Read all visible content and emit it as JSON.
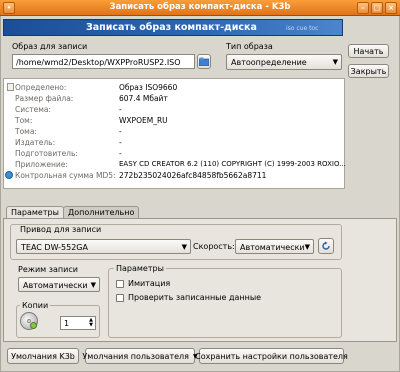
{
  "window": {
    "title": "Записать образ компакт-диска - K3b",
    "buttons": {
      "menu": "•",
      "minimize": "–",
      "maximize": "□",
      "close": "×"
    }
  },
  "header": {
    "title": "Записать образ компакт-диска",
    "subtitle": "iso cue toc"
  },
  "image_file": {
    "label": "Образ для записи",
    "value": "/home/wmd2/Desktop/WXPProRUSP2.ISO"
  },
  "image_type": {
    "label": "Тип образа",
    "value": "Автоопределение"
  },
  "actions": {
    "start": "Начать",
    "close": "Закрыть"
  },
  "info_rows": [
    {
      "key": "Определено:",
      "value": "Образ ISO9660"
    },
    {
      "key": "Размер файла:",
      "value": "607.4 Мбайт"
    },
    {
      "key": "Система:",
      "value": "-"
    },
    {
      "key": "Том:",
      "value": "WXPOEM_RU"
    },
    {
      "key": "Тома:",
      "value": "-"
    },
    {
      "key": "Издатель:",
      "value": "-"
    },
    {
      "key": "Подготовитель:",
      "value": "-"
    },
    {
      "key": "Приложение:",
      "value": "EASY CD CREATOR 6.2 (110) COPYRIGHT (C) 1999-2003 ROXIO..."
    },
    {
      "key": "Контрольная сумма MD5:",
      "value": "272b235024026afc84858fb5662a8711"
    }
  ],
  "tabs": {
    "params": "Параметры",
    "advanced": "Дополнительно"
  },
  "writer": {
    "label": "Привод для записи",
    "device": "TEAC DW-552GA",
    "speed_label": "Скорость:",
    "speed_value": "Автоматически"
  },
  "mode": {
    "label": "Режим записи",
    "value": "Автоматически"
  },
  "options": {
    "label": "Параметры",
    "simulate": "Имитация",
    "verify": "Проверить записанные данные"
  },
  "copies": {
    "label": "Копии",
    "value": "1"
  },
  "bottom": {
    "k3b_defaults": "Умолчания K3b",
    "user_defaults": "Умолчания пользователя",
    "save_user": "Сохранить настройки пользователя"
  },
  "colors": {
    "titlebar": "#e0731a",
    "banner": "#2e67b5"
  }
}
